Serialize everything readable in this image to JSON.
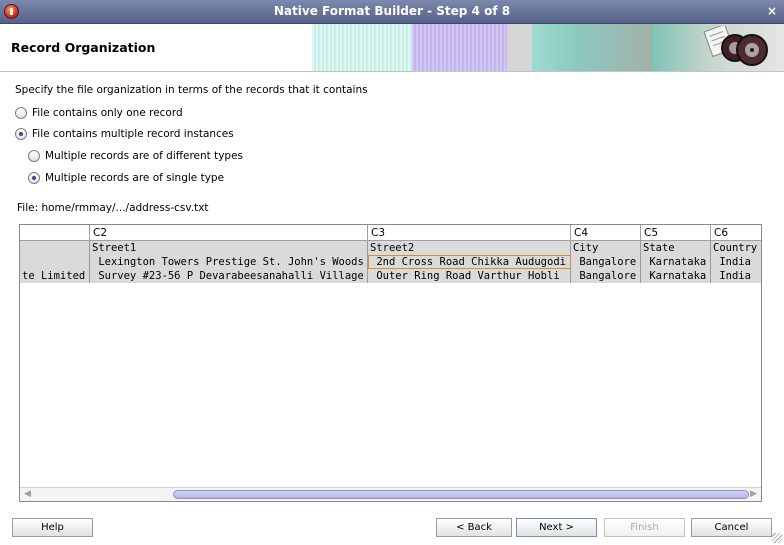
{
  "window": {
    "title": "Native Format Builder - Step 4 of 8",
    "close_glyph": "×"
  },
  "header": {
    "title": "Record Organization"
  },
  "content": {
    "instruction": "Specify the file organization in terms of the records that it contains",
    "options": {
      "single_record": {
        "label": "File contains only one record",
        "checked": false
      },
      "multiple_instances": {
        "label": "File contains multiple record instances",
        "checked": true
      },
      "different_types": {
        "label": "Multiple records are of different types",
        "checked": false
      },
      "single_type": {
        "label": "Multiple records are of single type",
        "checked": true
      }
    },
    "file_label": "File: home/rmmay/.../address-csv.txt"
  },
  "grid": {
    "columns": [
      {
        "header": "",
        "cells": [
          "",
          "",
          "te Limited"
        ]
      },
      {
        "header": "C2",
        "cells": [
          "Street1",
          " Lexington Towers Prestige St. John's Woods",
          " Survey #23-56 P Devarabeesanahalli Village"
        ]
      },
      {
        "header": "C3",
        "cells": [
          "Street2",
          " 2nd Cross Road Chikka Audugodi",
          " Outer Ring Road Varthur Hobli"
        ]
      },
      {
        "header": "C4",
        "cells": [
          "City",
          " Bangalore",
          " Bangalore"
        ]
      },
      {
        "header": "C5",
        "cells": [
          "State",
          " Karnataka",
          " Karnataka"
        ]
      },
      {
        "header": "C6",
        "cells": [
          "Country",
          " India",
          " India"
        ]
      }
    ]
  },
  "buttons": {
    "help": "Help",
    "back": "< Back",
    "next": "Next >",
    "finish": "Finish",
    "cancel": "Cancel"
  },
  "colors": {
    "titlebar": "#6b76a0",
    "grid_cell": "#dadada",
    "selection": "#e08a2a",
    "scroll_thumb": "#b8b8e8"
  }
}
